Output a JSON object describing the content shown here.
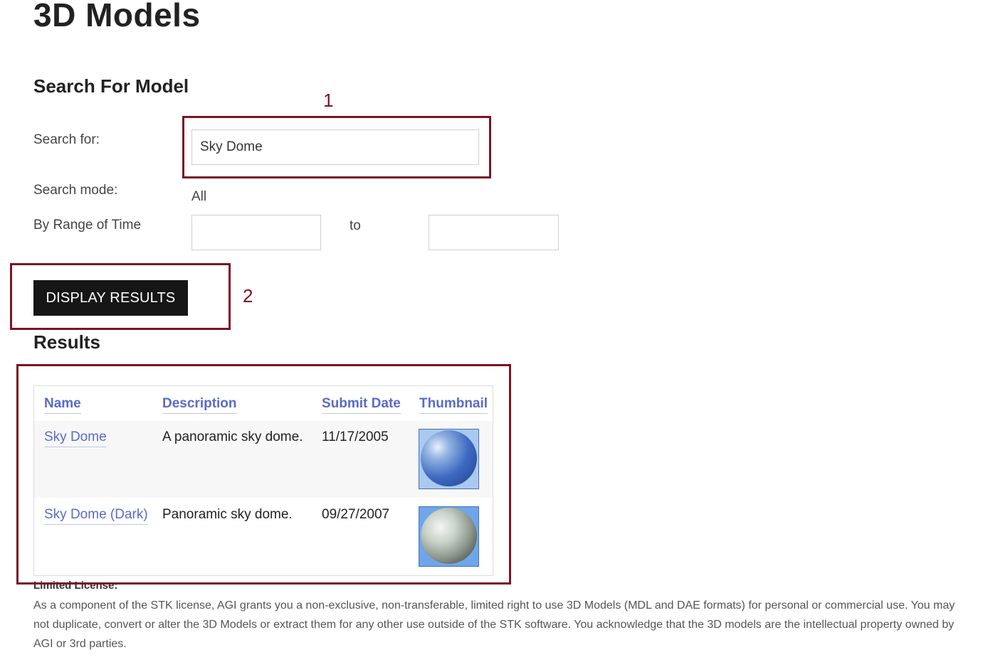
{
  "page": {
    "title": "3D Models"
  },
  "search": {
    "section_title": "Search For Model",
    "search_for_label": "Search for:",
    "search_for_value": "Sky Dome",
    "mode_label": "Search mode:",
    "mode_value": "All",
    "range_label": "By Range of Time",
    "range_start_value": "",
    "range_to_label": "to",
    "range_end_value": "",
    "button_label": "DISPLAY RESULTS"
  },
  "results": {
    "title": "Results",
    "columns": [
      "Name",
      "Description",
      "Submit Date",
      "Thumbnail"
    ],
    "rows": [
      {
        "name": "Sky Dome",
        "description": "A panoramic sky dome.",
        "submit_date": "11/17/2005",
        "thumbnail": "sky-dome-thumbnail"
      },
      {
        "name": "Sky Dome (Dark)",
        "description": "Panoramic sky dome.",
        "submit_date": "09/27/2007",
        "thumbnail": "sky-dome-dark-thumbnail"
      }
    ]
  },
  "annotations": {
    "first": "1",
    "second": "2",
    "color": "#7a1426"
  },
  "license": {
    "title": "Limited License:",
    "text": "As a component of the STK license, AGI grants you a non-exclusive, non-transferable, limited right to use 3D Models (MDL and DAE formats) for personal or commercial use. You may not duplicate, convert or alter the 3D Models or extract them for any other use outside of the STK software. You acknowledge that the 3D models are the intellectual property owned by AGI or 3rd parties."
  },
  "colors": {
    "link": "#5a6ac9",
    "button_bg": "#161616",
    "annotation": "#7a1426"
  }
}
